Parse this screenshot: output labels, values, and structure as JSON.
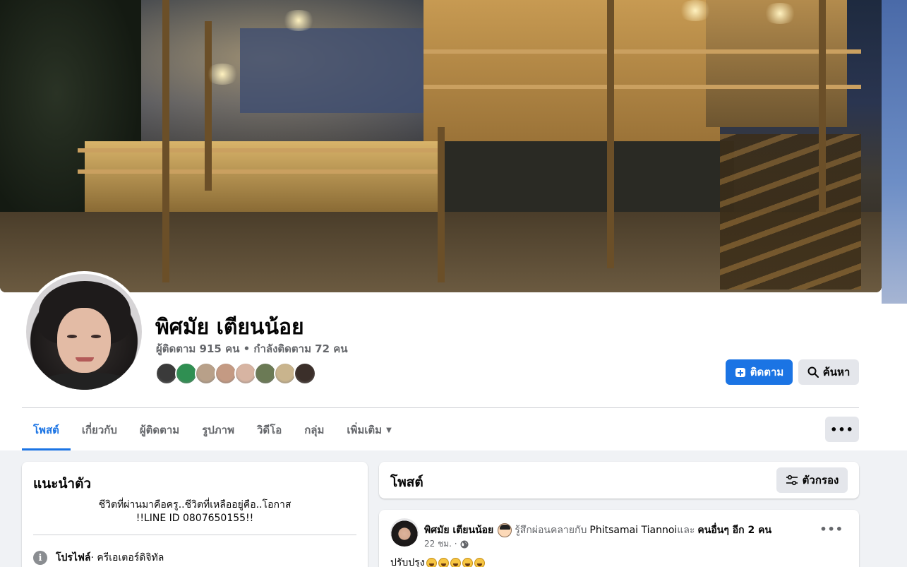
{
  "profile": {
    "name": "พิศมัย เตียนน้อย",
    "stats": "ผู้ติดตาม 915 คน • กำลังติดตาม 72 คน",
    "follower_faces": [
      {
        "color": "#3a3a3a"
      },
      {
        "color": "#2f8f52"
      },
      {
        "color": "#b8a089"
      },
      {
        "color": "#c49a83"
      },
      {
        "color": "#d7b4a2"
      },
      {
        "color": "#6b7a55"
      },
      {
        "color": "#c9b48d"
      },
      {
        "color": "#3b2f2a"
      }
    ]
  },
  "actions": {
    "follow_label": "ติดตาม",
    "search_label": "ค้นหา",
    "more_label": "•••"
  },
  "tabs": [
    {
      "label": "โพสต์",
      "active": true
    },
    {
      "label": "เกี่ยวกับ",
      "active": false
    },
    {
      "label": "ผู้ติดตาม",
      "active": false
    },
    {
      "label": "รูปภาพ",
      "active": false
    },
    {
      "label": "วิดีโอ",
      "active": false
    },
    {
      "label": "กลุ่ม",
      "active": false
    },
    {
      "label": "เพิ่มเติม",
      "active": false
    }
  ],
  "intro": {
    "title": "แนะนำตัว",
    "bio_line1": "ชีวิตที่ผ่านมาคือครู..ชีวิตที่เหลืออยู่คือ..โอกาส",
    "bio_line2": "!!LINE ID 0807650155!!",
    "profile_label": "โปรไฟล์",
    "profile_value": " · ครีเอเตอร์ดิจิทัล"
  },
  "posts": {
    "title": "โพสต์",
    "filter_label": "ตัวกรอง"
  },
  "post": {
    "author": "พิศมัย เตียนน้อย",
    "feeling": "รู้สึกผ่อนคลายกับ",
    "tagged": "Phitsamai Tiannoi",
    "and": " และ",
    "others": "คนอื่นๆ อีก 2 คน",
    "time": "22 ชม. ·",
    "text": "ปรับปรุง",
    "laugh_count": 5
  },
  "colors": {
    "accent": "#1b74e4",
    "secondary_text": "#65676b",
    "background": "#f0f2f5"
  }
}
